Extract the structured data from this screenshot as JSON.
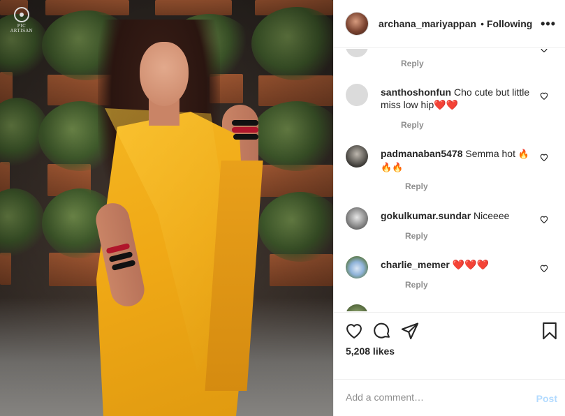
{
  "photo": {
    "watermark": "PIC ARTISAN"
  },
  "header": {
    "username": "archana_mariyappan",
    "separator": "•",
    "follow_status": "Following",
    "more_icon": "more-horizontal-icon"
  },
  "comments": [
    {
      "username": "",
      "text": "",
      "reply_label": "Reply",
      "partial": true
    },
    {
      "username": "santhoshonfun",
      "text": "Cho cute but little miss low hip",
      "emojis": "❤️❤️",
      "reply_label": "Reply"
    },
    {
      "username": "padmanaban5478",
      "text": "Semma hot",
      "emojis": "🔥🔥🔥",
      "reply_label": "Reply"
    },
    {
      "username": "gokulkumar.sundar",
      "text": "Niceeee",
      "emojis": "",
      "reply_label": "Reply"
    },
    {
      "username": "charlie_memer",
      "text": "",
      "emojis": "❤️❤️❤️",
      "reply_label": "Reply"
    }
  ],
  "actions": {
    "like_icon": "heart-icon",
    "comment_icon": "comment-icon",
    "share_icon": "share-icon",
    "save_icon": "bookmark-icon",
    "likes_text": "5,208 likes"
  },
  "add_comment": {
    "placeholder": "Add a comment…",
    "post_label": "Post"
  },
  "colors": {
    "text_primary": "#262626",
    "text_secondary": "#8e8e8e",
    "border": "#efefef",
    "post_disabled": "#b3dbff",
    "heart_red": "#e0202f"
  }
}
